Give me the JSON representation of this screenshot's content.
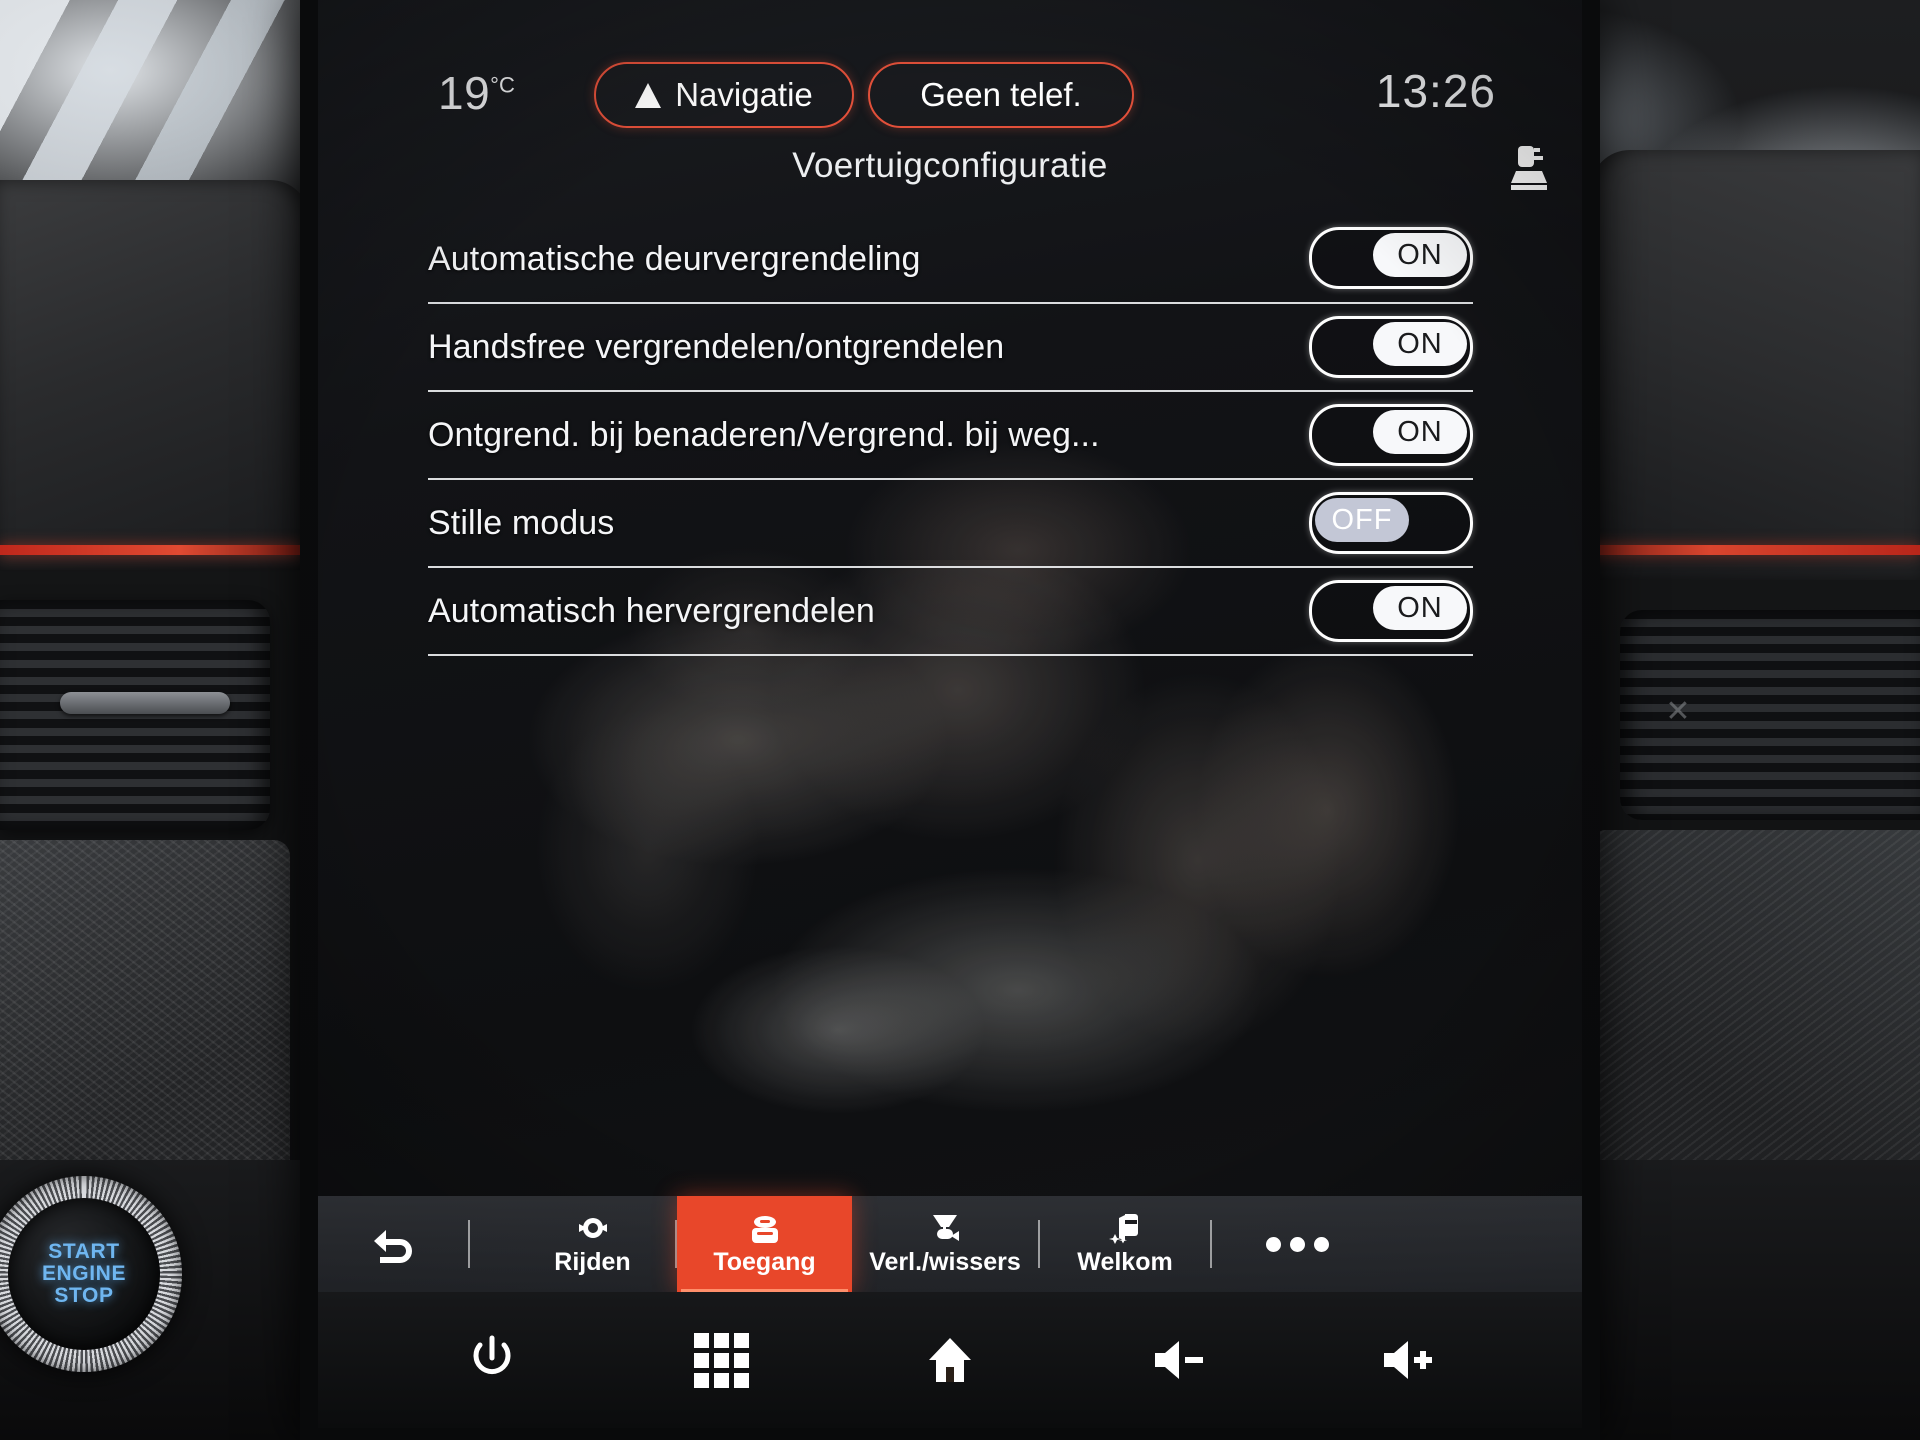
{
  "statusbar": {
    "temperature": "19",
    "temperature_unit": "°C",
    "nav_label": "Navigatie",
    "nav_icon": "navigation-arrow-icon",
    "phone_label": "Geen telef.",
    "clock": "13:26",
    "accent_color": "#e2503a"
  },
  "header": {
    "title": "Voertuigconfiguratie",
    "right_icon": "car-seat-icon"
  },
  "settings": {
    "rows": [
      {
        "label": "Automatische deurvergrendeling",
        "state": "ON"
      },
      {
        "label": "Handsfree vergrendelen/ontgrendelen",
        "state": "ON"
      },
      {
        "label": "Ontgrend. bij benaderen/Vergrend. bij weg...",
        "state": "ON"
      },
      {
        "label": "Stille modus",
        "state": "OFF"
      },
      {
        "label": "Automatisch hervergrendelen",
        "state": "ON"
      }
    ]
  },
  "tabbar": {
    "back_icon": "back-arrow-icon",
    "active_color": "#e8472a",
    "tabs": [
      {
        "label": "Rijden",
        "icon": "steering-settings-icon",
        "active": false
      },
      {
        "label": "Toegang",
        "icon": "car-key-fob-icon",
        "active": true
      },
      {
        "label": "Verl./wissers",
        "icon": "wiper-light-icon",
        "active": false
      },
      {
        "label": "Welkom",
        "icon": "welcome-lighting-icon",
        "active": false
      }
    ],
    "more_icon": "more-dots-icon"
  },
  "sysbar": {
    "buttons": [
      {
        "icon": "power-icon"
      },
      {
        "icon": "apps-grid-icon"
      },
      {
        "icon": "home-icon"
      },
      {
        "icon": "volume-down-icon"
      },
      {
        "icon": "volume-up-icon"
      }
    ]
  },
  "dashboard": {
    "start_stop_line1": "START",
    "start_stop_line2": "ENGINE",
    "start_stop_line3": "STOP"
  }
}
